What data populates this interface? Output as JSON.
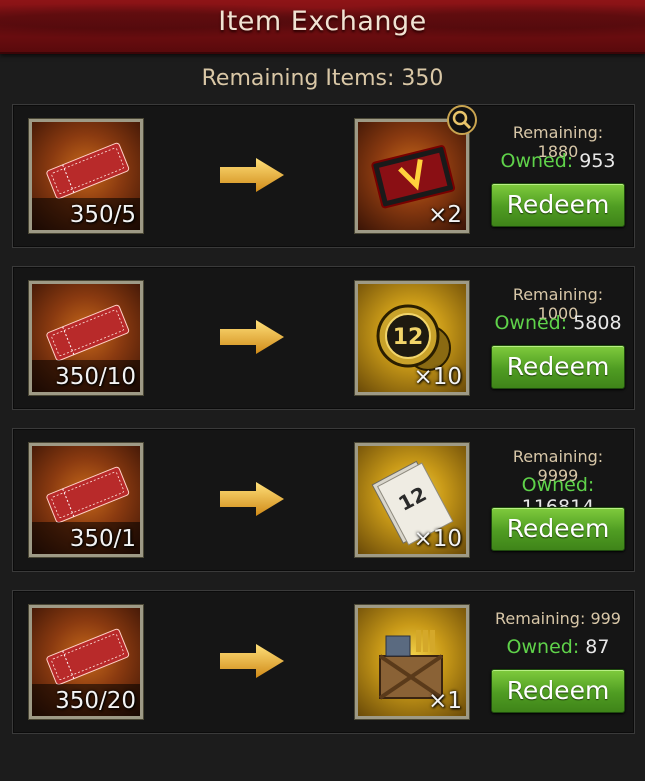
{
  "header": {
    "title": "Item Exchange"
  },
  "summary": {
    "remaining_text": "Remaining Items: 350"
  },
  "colors": {
    "redeem_green": "#5aa82a",
    "owned_green": "#5fd24a",
    "header_red": "#7a0f12"
  },
  "rows": [
    {
      "cost_text": "350/5",
      "cost_icon": "tactical-crew-ticket-icon",
      "reward_icon": "red-card-icon",
      "reward_qty": "×2",
      "remaining_label": "Remaining: ",
      "remaining_value": "1880",
      "owned_label": "Owned: ",
      "owned_value": "953",
      "button_label": "Redeem"
    },
    {
      "cost_text": "350/10",
      "cost_icon": "tactical-crew-ticket-icon",
      "reward_icon": "gold-coin-icon",
      "reward_qty": "×10",
      "remaining_label": "Remaining: ",
      "remaining_value": "1000",
      "owned_label": "Owned: ",
      "owned_value": "5808",
      "button_label": "Redeem"
    },
    {
      "cost_text": "350/1",
      "cost_icon": "tactical-crew-ticket-icon",
      "reward_icon": "mafia-document-icon",
      "reward_qty": "×10",
      "remaining_label": "Remaining: ",
      "remaining_value": "9999",
      "owned_label": "Owned: ",
      "owned_value": "116814",
      "button_label": "Redeem"
    },
    {
      "cost_text": "350/20",
      "cost_icon": "tactical-crew-ticket-icon",
      "reward_icon": "ammo-crate-icon",
      "reward_qty": "×1",
      "remaining_label": "Remaining: ",
      "remaining_value": "999",
      "owned_label": "Owned: ",
      "owned_value": "87",
      "button_label": "Redeem"
    }
  ],
  "icons": {
    "magnifier": "magnifier-icon",
    "arrow": "arrow-right-icon"
  }
}
